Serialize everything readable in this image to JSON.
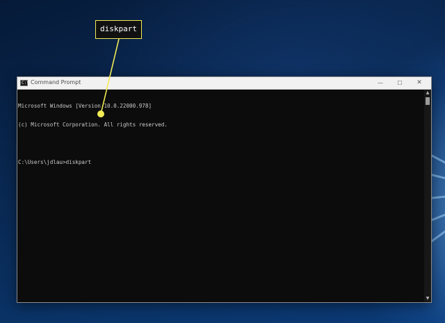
{
  "window": {
    "title": "Command Prompt",
    "icon": "cmd-icon",
    "icon_glyph": "C:\\",
    "controls": {
      "minimize": "—",
      "maximize": "☐",
      "close": "✕"
    }
  },
  "console": {
    "lines": [
      "Microsoft Windows [Version 10.0.22000.978]",
      "(c) Microsoft Corporation. All rights reserved.",
      "",
      "C:\\Users\\jdlau>diskpart"
    ]
  },
  "scrollbar": {
    "up_glyph": "▲",
    "down_glyph": "▼"
  },
  "callout": {
    "text": "diskpart",
    "color": "#f2ec55"
  },
  "colors": {
    "console_bg": "#0c0c0c",
    "console_text": "#cccccc",
    "titlebar_bg": "#f1f1f1",
    "callout_border": "#f2ec55"
  }
}
